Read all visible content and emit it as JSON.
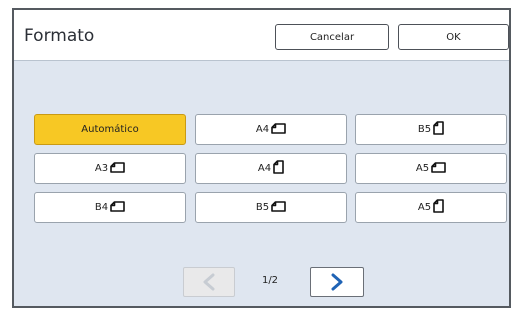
{
  "dialog": {
    "title": "Formato",
    "cancel_label": "Cancelar",
    "ok_label": "OK"
  },
  "sizes": [
    {
      "label": "Automático",
      "icon": "",
      "selected": true
    },
    {
      "label": "A4",
      "icon": "landscape-paper-icon",
      "selected": false
    },
    {
      "label": "B5",
      "icon": "portrait-paper-icon",
      "selected": false
    },
    {
      "label": "A3",
      "icon": "landscape-paper-icon",
      "selected": false
    },
    {
      "label": "A4",
      "icon": "portrait-paper-icon",
      "selected": false
    },
    {
      "label": "A5",
      "icon": "landscape-paper-icon",
      "selected": false
    },
    {
      "label": "B4",
      "icon": "landscape-paper-icon",
      "selected": false
    },
    {
      "label": "B5",
      "icon": "landscape-paper-icon",
      "selected": false
    },
    {
      "label": "A5",
      "icon": "portrait-paper-icon",
      "selected": false
    }
  ],
  "pager": {
    "indicator": "1/2",
    "prev_enabled": false,
    "next_enabled": true
  },
  "colors": {
    "selected": "#f7c824",
    "panel": "#dfe6f0",
    "arrow_active": "#1f63b5",
    "arrow_disabled": "#c7ccd3"
  }
}
